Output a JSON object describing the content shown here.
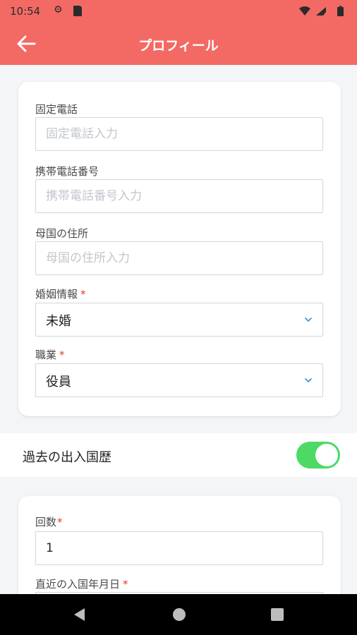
{
  "status_bar": {
    "time": "10:54",
    "icons": [
      "gear-icon",
      "sd-card-icon",
      "wifi-icon",
      "signal-icon",
      "battery-icon"
    ]
  },
  "app_bar": {
    "title": "プロフィール",
    "back_icon": "arrow-left-icon",
    "color": "#f36a64"
  },
  "form_1": {
    "landline": {
      "label": "固定電話",
      "placeholder": "固定電話入力",
      "value": ""
    },
    "mobile": {
      "label": "携帯電話番号",
      "placeholder": "携帯電話番号入力",
      "value": ""
    },
    "home_address": {
      "label": "母国の住所",
      "placeholder": "母国の住所入力",
      "value": ""
    },
    "marital_status": {
      "label": "婚姻情報",
      "required_mark": "*",
      "value": "未婚"
    },
    "occupation": {
      "label": "職業",
      "required_mark": "*",
      "value": "役員"
    }
  },
  "immigration_history": {
    "label": "過去の出入国歴",
    "enabled": true,
    "toggle_color": "#4cd964"
  },
  "form_2": {
    "count": {
      "label": "回数",
      "required_mark": "*",
      "value": "1"
    },
    "last_entry_date": {
      "label": "直近の入国年月日",
      "required_mark": "*"
    }
  },
  "nav_bar": {
    "back": "triangle-back-icon",
    "home": "circle-home-icon",
    "recents": "square-recents-icon"
  },
  "colors": {
    "required": "#e53935",
    "accent": "#f36a64"
  }
}
